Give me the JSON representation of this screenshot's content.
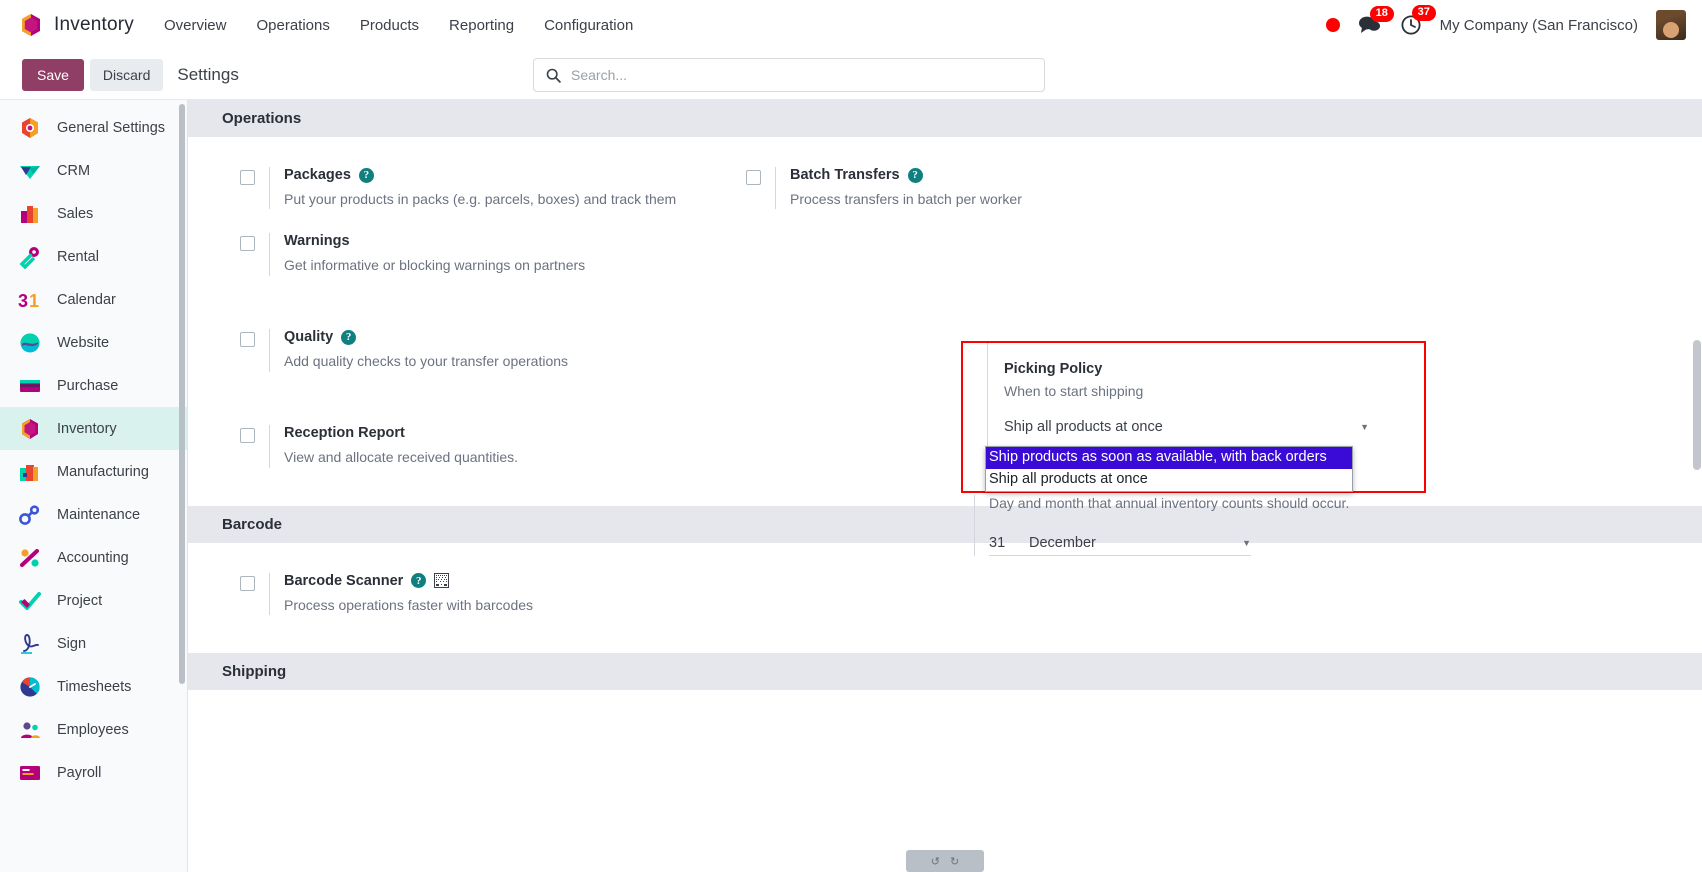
{
  "navbar": {
    "app_name": "Inventory",
    "logo_icon": "odoo-hexagon-icon",
    "menu": [
      {
        "label": "Overview"
      },
      {
        "label": "Operations"
      },
      {
        "label": "Products"
      },
      {
        "label": "Reporting"
      },
      {
        "label": "Configuration"
      }
    ],
    "recording_indicator": "record-dot-icon",
    "messages_icon": "chat-bubble-icon",
    "messages_count": "18",
    "activities_icon": "clock-icon",
    "activities_count": "37",
    "company": "My Company (San Francisco)",
    "avatar_icon": "user-avatar"
  },
  "control_panel": {
    "save_label": "Save",
    "discard_label": "Discard",
    "title": "Settings",
    "search_icon": "search-icon",
    "search_placeholder": "Search...",
    "search_value": ""
  },
  "sidebar": {
    "items": [
      {
        "label": "General Settings",
        "icon": "settings-gear-icon",
        "active": false
      },
      {
        "label": "CRM",
        "icon": "crm-icon",
        "active": false
      },
      {
        "label": "Sales",
        "icon": "sales-chart-icon",
        "active": false
      },
      {
        "label": "Rental",
        "icon": "rental-key-icon",
        "active": false
      },
      {
        "label": "Calendar",
        "icon": "calendar-31-icon",
        "active": false
      },
      {
        "label": "Website",
        "icon": "website-globe-icon",
        "active": false
      },
      {
        "label": "Purchase",
        "icon": "purchase-card-icon",
        "active": false
      },
      {
        "label": "Inventory",
        "icon": "inventory-box-icon",
        "active": true
      },
      {
        "label": "Manufacturing",
        "icon": "manufacturing-icon",
        "active": false
      },
      {
        "label": "Maintenance",
        "icon": "maintenance-wrench-icon",
        "active": false
      },
      {
        "label": "Accounting",
        "icon": "accounting-icon",
        "active": false
      },
      {
        "label": "Project",
        "icon": "project-check-icon",
        "active": false
      },
      {
        "label": "Sign",
        "icon": "sign-signature-icon",
        "active": false
      },
      {
        "label": "Timesheets",
        "icon": "timesheets-clock-icon",
        "active": false
      },
      {
        "label": "Employees",
        "icon": "employees-icon",
        "active": false
      },
      {
        "label": "Payroll",
        "icon": "payroll-icon",
        "active": false
      }
    ]
  },
  "sections": {
    "operations": {
      "header": "Operations",
      "packages": {
        "title": "Packages",
        "desc": "Put your products in packs (e.g. parcels, boxes) and track them",
        "checked": false,
        "help": "?"
      },
      "batch_transfers": {
        "title": "Batch Transfers",
        "desc": "Process transfers in batch per worker",
        "checked": false,
        "help": "?"
      },
      "warnings": {
        "title": "Warnings",
        "desc": "Get informative or blocking warnings on partners",
        "checked": false
      },
      "quality": {
        "title": "Quality",
        "desc": "Add quality checks to your transfer operations",
        "checked": false,
        "help": "?"
      },
      "reception_report": {
        "title": "Reception Report",
        "desc": "View and allocate received quantities.",
        "checked": false
      },
      "picking_policy": {
        "title": "Picking Policy",
        "desc": "When to start shipping",
        "selected_value": "Ship all products at once",
        "options": [
          {
            "label": "Ship products as soon as available, with back orders",
            "highlighted": true
          },
          {
            "label": "Ship all products at once",
            "highlighted": false
          }
        ],
        "caret_icon": "chevron-down-icon"
      },
      "annual_inventory": {
        "desc": "Day and month that annual inventory counts should occur.",
        "day": "31",
        "month": "December",
        "caret_icon": "chevron-down-icon"
      }
    },
    "barcode": {
      "header": "Barcode",
      "barcode_scanner": {
        "title": "Barcode Scanner",
        "desc": "Process operations faster with barcodes",
        "checked": false,
        "help": "?",
        "extra_icon": "barcode-grid-icon"
      }
    },
    "shipping": {
      "header": "Shipping"
    }
  },
  "misc": {
    "undo_icon": "undo-icon",
    "redo_icon": "redo-icon"
  },
  "colors": {
    "brand_purple": "#714b67",
    "save_button": "#8f3f65",
    "active_sidebar": "#d9f2ee",
    "help_teal": "#107f7f",
    "highlight_red": "#ff0000",
    "dropdown_selected_blue": "#3a0ad6",
    "badge_red": "#ff0000"
  }
}
